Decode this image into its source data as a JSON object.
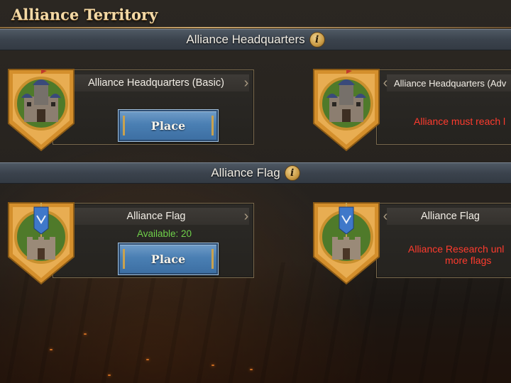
{
  "window": {
    "title": "Alliance Territory"
  },
  "sections": {
    "headquarters": {
      "title": "Alliance Headquarters"
    },
    "flag": {
      "title": "Alliance Flag"
    }
  },
  "cards": {
    "hq_basic": {
      "name": "Alliance Headquarters (Basic)",
      "button": "Place"
    },
    "hq_advanced": {
      "name": "Alliance Headquarters (Adv",
      "warning": "Alliance must reach l"
    },
    "flag_left": {
      "name": "Alliance Flag",
      "available": "Available: 20",
      "button": "Place"
    },
    "flag_right": {
      "name": "Alliance Flag",
      "warning_line1": "Alliance Research unl",
      "warning_line2": "more flags"
    }
  },
  "icons": {
    "info": "info-icon",
    "chevron_left": "chevron-left-icon",
    "chevron_right": "chevron-right-icon"
  },
  "colors": {
    "title": "#f3d9a6",
    "button": "#4a7fb3",
    "warning": "#ff3b2e",
    "available": "#6fd04a",
    "badge": "#e0a23a"
  }
}
